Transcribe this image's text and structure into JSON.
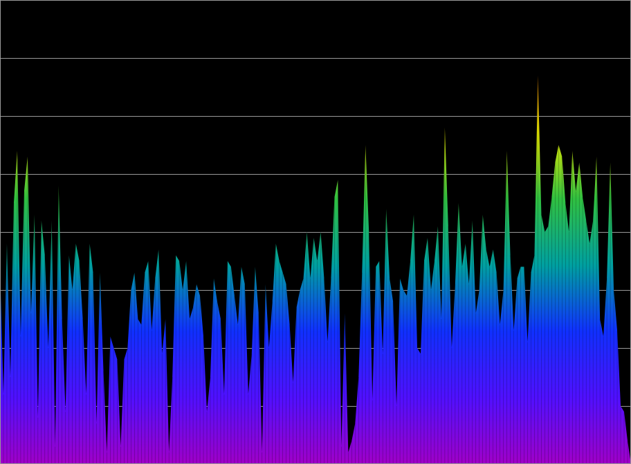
{
  "chart_data": {
    "type": "area",
    "title": "",
    "xlabel": "",
    "ylabel": "",
    "ylim": [
      0,
      8
    ],
    "grid_lines": 7,
    "grid": true,
    "gradient_colors": [
      "#a000c8",
      "#5010ff",
      "#1030ff",
      "#00a0a0",
      "#30c040",
      "#e8e800",
      "#ff8000",
      "#ff2000"
    ],
    "background": "#000000",
    "grid_color": "#9a9a9a",
    "values": [
      3.4,
      1.2,
      3.8,
      1.5,
      4.5,
      5.4,
      2.2,
      4.7,
      5.3,
      2.6,
      4.3,
      0.8,
      4.2,
      3.6,
      2.0,
      4.2,
      0.3,
      4.8,
      2.5,
      0.9,
      3.6,
      3.0,
      3.8,
      3.5,
      2.5,
      1.2,
      3.8,
      3.3,
      0.7,
      3.3,
      1.6,
      0.2,
      2.2,
      2.0,
      1.8,
      0.3,
      1.8,
      2.0,
      3.0,
      3.3,
      2.5,
      2.4,
      3.3,
      3.5,
      2.3,
      3.2,
      3.7,
      1.9,
      2.5,
      0.2,
      1.5,
      3.6,
      3.5,
      3.0,
      3.5,
      2.5,
      2.7,
      3.1,
      2.9,
      2.2,
      0.9,
      1.5,
      3.2,
      2.8,
      2.5,
      1.2,
      3.5,
      3.4,
      2.9,
      2.4,
      3.4,
      3.1,
      1.2,
      1.9,
      3.4,
      2.6,
      0.2,
      3.1,
      2.0,
      2.8,
      3.8,
      3.5,
      3.3,
      3.1,
      2.4,
      1.4,
      2.7,
      3.0,
      3.2,
      4.0,
      3.2,
      3.9,
      3.5,
      4.0,
      3.2,
      2.1,
      3.2,
      4.6,
      4.9,
      0.3,
      2.6,
      0.2,
      0.4,
      0.7,
      1.5,
      3.3,
      5.5,
      4.0,
      1.1,
      3.4,
      3.5,
      1.9,
      4.4,
      3.2,
      2.8,
      1.0,
      3.2,
      3.0,
      2.9,
      3.5,
      4.3,
      2.0,
      1.9,
      3.5,
      3.9,
      3.0,
      3.5,
      4.1,
      2.5,
      5.8,
      4.1,
      2.0,
      3.1,
      4.5,
      3.4,
      3.8,
      3.1,
      4.2,
      2.6,
      3.0,
      4.3,
      3.7,
      3.4,
      3.7,
      3.3,
      2.4,
      3.0,
      5.4,
      3.6,
      2.3,
      3.2,
      3.4,
      3.4,
      2.1,
      3.3,
      3.6,
      6.7,
      4.3,
      4.0,
      4.1,
      4.6,
      5.2,
      5.5,
      5.3,
      4.5,
      4.0,
      5.4,
      4.7,
      5.2,
      4.6,
      4.2,
      3.8,
      4.2,
      5.3,
      2.5,
      2.2,
      3.2,
      5.2,
      3.0,
      2.3,
      1.0,
      0.9,
      0.4,
      0.0
    ]
  }
}
